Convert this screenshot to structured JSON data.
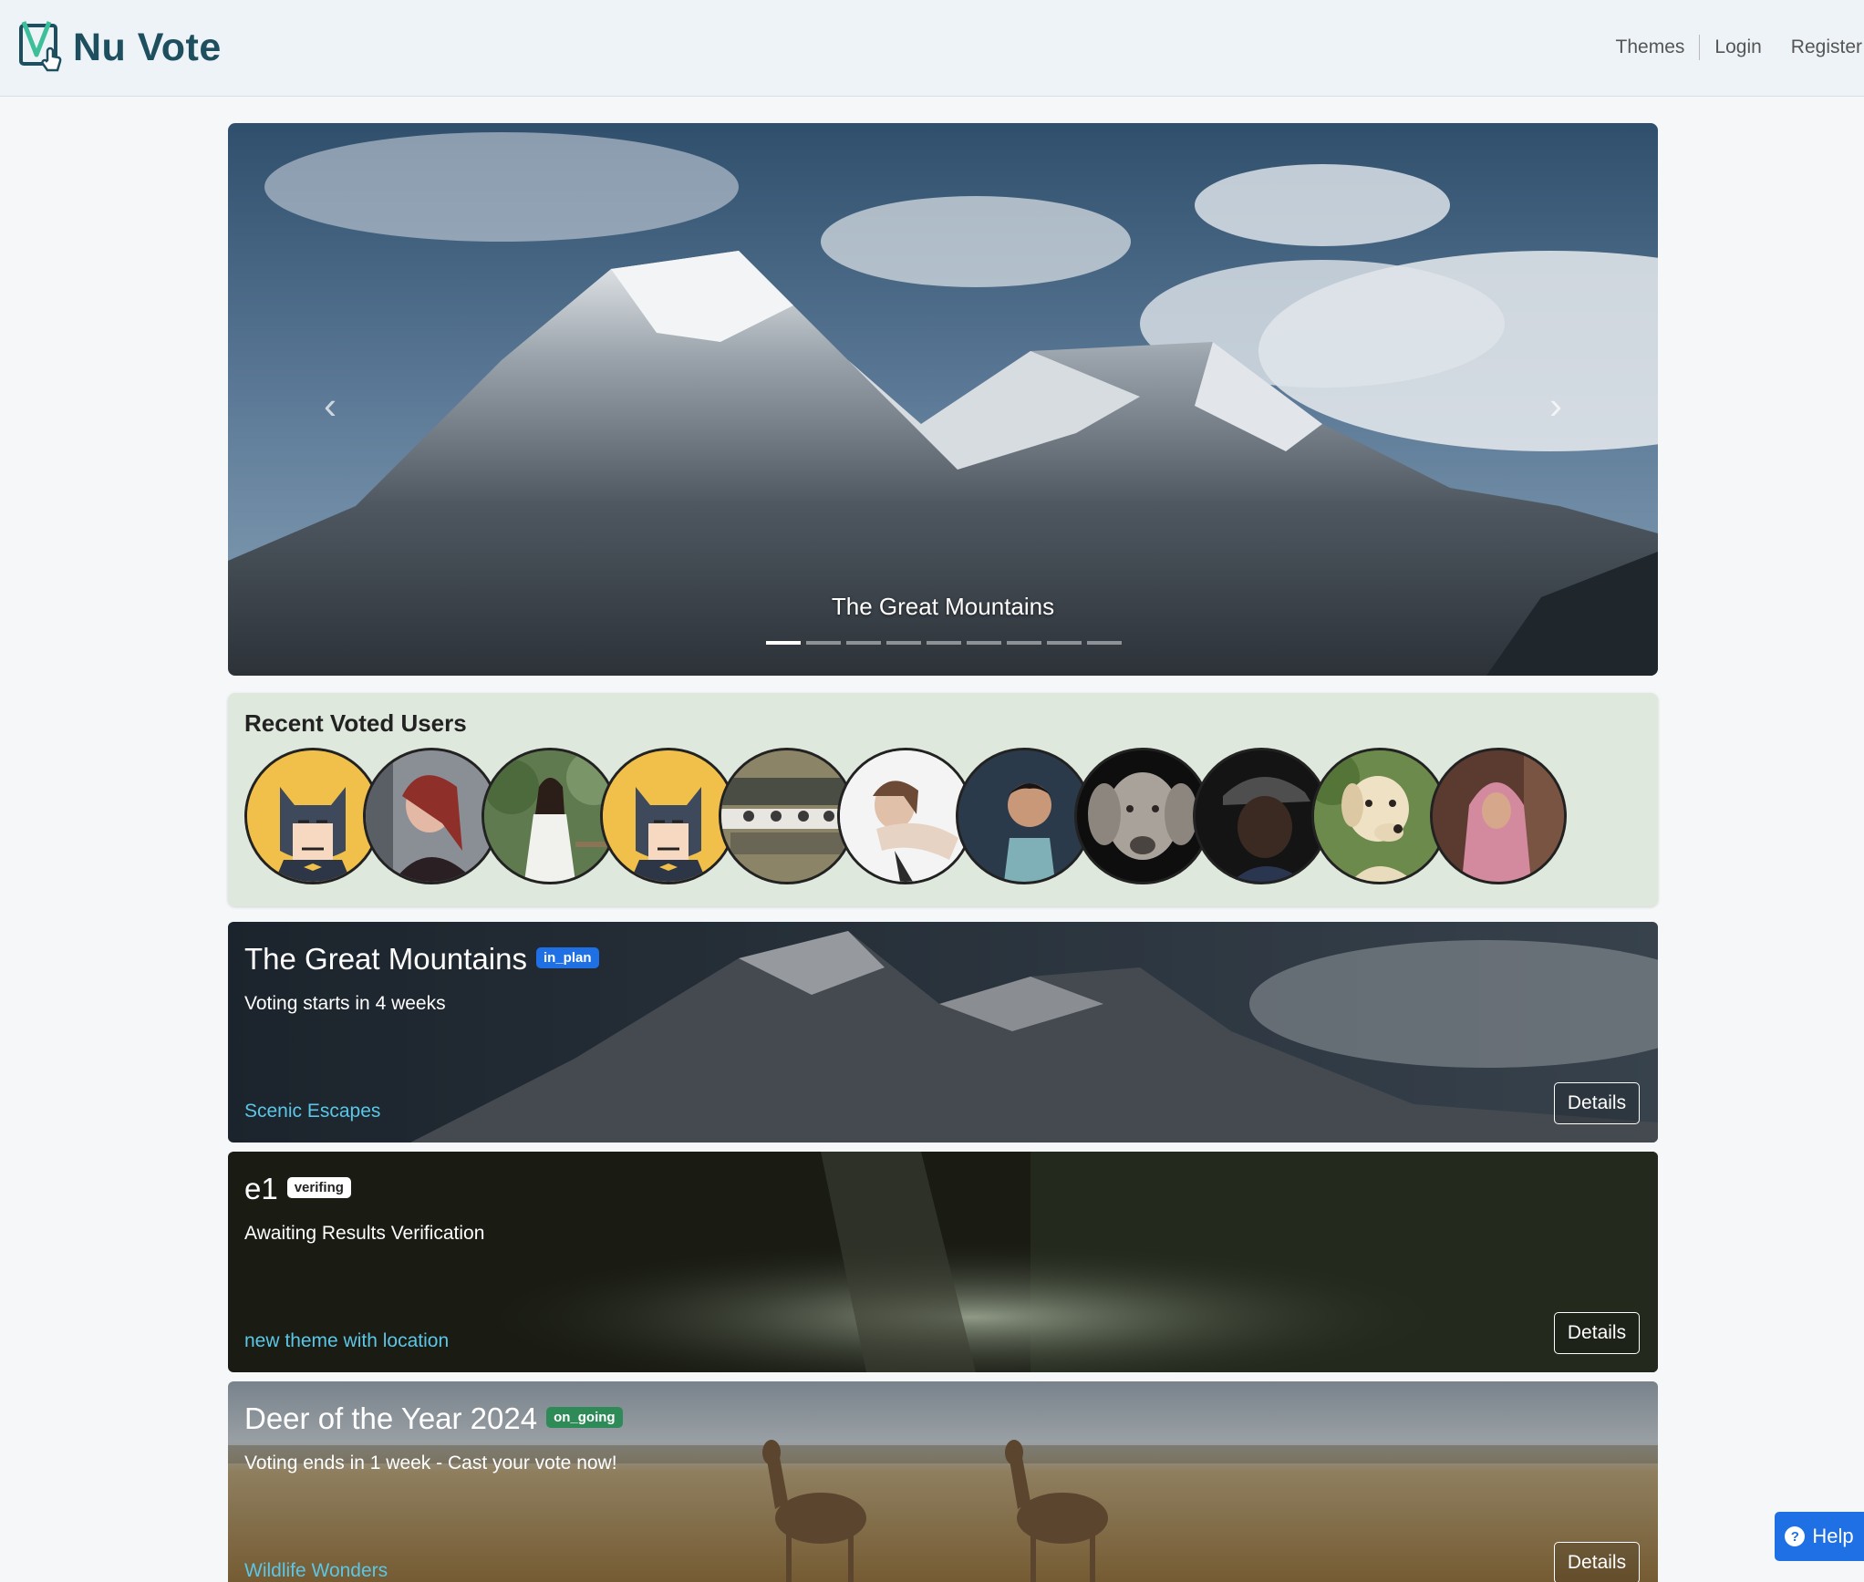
{
  "navbar": {
    "brand": "Nu Vote",
    "links": [
      "Themes",
      "Login",
      "Register"
    ]
  },
  "carousel": {
    "caption": "The Great Mountains",
    "slide_count": 9,
    "active_index": 0,
    "prev_icon": "chevron-left-icon",
    "next_icon": "chevron-right-icon"
  },
  "recent_users": {
    "title": "Recent Voted Users",
    "avatars": [
      "batman",
      "woman-red-hair",
      "woman-white-dress",
      "batman",
      "group-photo",
      "woman-portrait",
      "child",
      "dog-weimaraner",
      "man-cap",
      "dog-labrador",
      "woman-hijab"
    ]
  },
  "themes": [
    {
      "title": "The Great Mountains",
      "status": "in_plan",
      "subtitle": "Voting starts in 4 weeks",
      "category": "Scenic Escapes",
      "button": "Details"
    },
    {
      "title": "e1",
      "status": "verifing",
      "subtitle": "Awaiting Results Verification",
      "category": "new theme with location",
      "button": "Details"
    },
    {
      "title": "Deer of the Year 2024",
      "status": "on_going",
      "subtitle": "Voting ends in 1 week - Cast your vote now!",
      "category": "Wildlife Wonders",
      "button": "Details"
    }
  ],
  "help": {
    "label": "Help",
    "icon": "question-circle-icon"
  },
  "colors": {
    "brand": "#1e4f5f",
    "accent": "#1f6fe5",
    "in_plan": "#1f6fe5",
    "on_going": "#2e8b57",
    "category_link": "#5bc6e6",
    "recent_bg": "#dfe8dc"
  }
}
